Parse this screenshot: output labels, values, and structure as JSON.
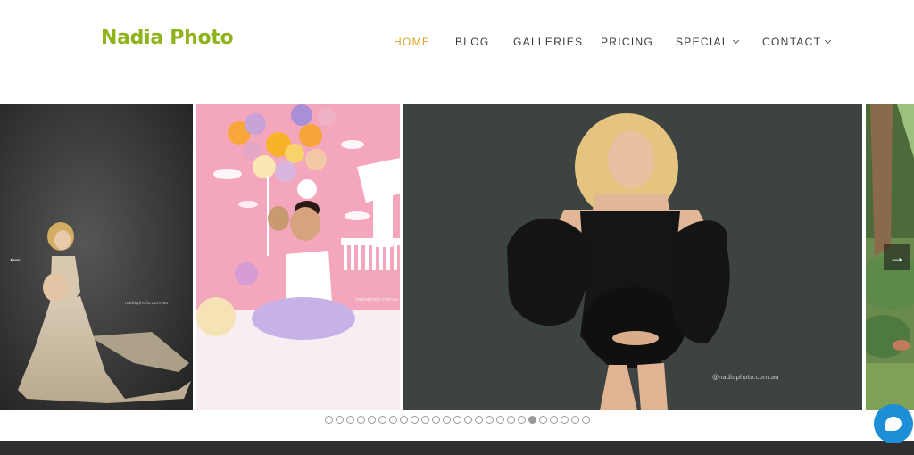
{
  "brand": {
    "logo_text": "Nadia Photo",
    "logo_color": "#8fb31a"
  },
  "nav": {
    "items": [
      {
        "label": "HOME",
        "active": true
      },
      {
        "label": "BLOG"
      },
      {
        "label": "GALLERIES"
      },
      {
        "label": "PRICING"
      },
      {
        "label": "SPECIAL",
        "has_dropdown": true
      },
      {
        "label": "CONTACT",
        "has_dropdown": true
      }
    ],
    "active_color": "#d9a425"
  },
  "slider": {
    "slides": [
      {
        "description": "maternity gown on dark backdrop",
        "watermark": "nadiaphoto.com.au"
      },
      {
        "description": "baby first birthday with balloons and tutu",
        "watermark": "nadiaphoto.com.au"
      },
      {
        "description": "maternity black bodysuit with ruffled sleeves",
        "watermark": "@nadiaphoto.com.au"
      },
      {
        "description": "outdoor garden scene",
        "watermark": ""
      }
    ],
    "prev_icon": "←",
    "next_icon": "→",
    "total_dots": 25,
    "active_dot_index": 19
  },
  "chat": {
    "icon": "chat-bubble-icon",
    "color": "#1e8fd6"
  }
}
